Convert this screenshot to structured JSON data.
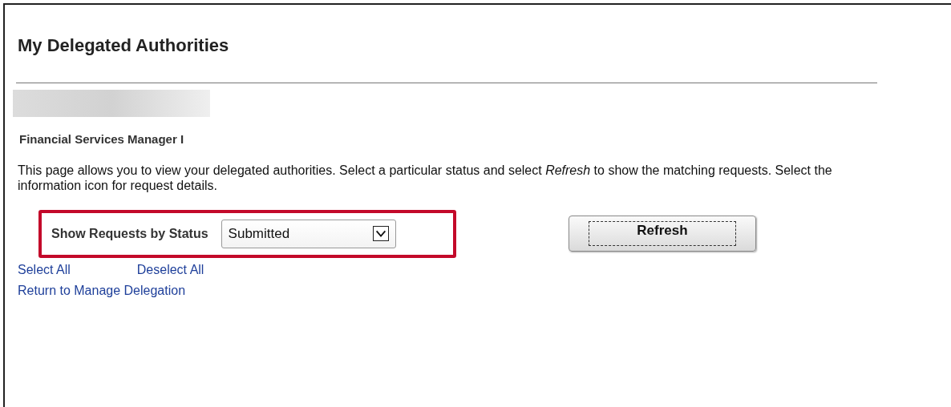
{
  "page": {
    "title": "My Delegated Authorities"
  },
  "role": "Financial Services Manager I",
  "description": "This page allows you to view your delegated authorities. Select a particular status and select *Refresh* to show the matching requests. Select the information icon for request details.",
  "filter": {
    "label": "Show Requests by Status",
    "value": "Submitted",
    "highlighted": true
  },
  "refresh_button": {
    "label": "Refresh",
    "focused": true
  },
  "links": [
    {
      "label": "Select All"
    },
    {
      "label": "Deselect All"
    },
    {
      "label": "Return to Manage Delegation"
    }
  ]
}
